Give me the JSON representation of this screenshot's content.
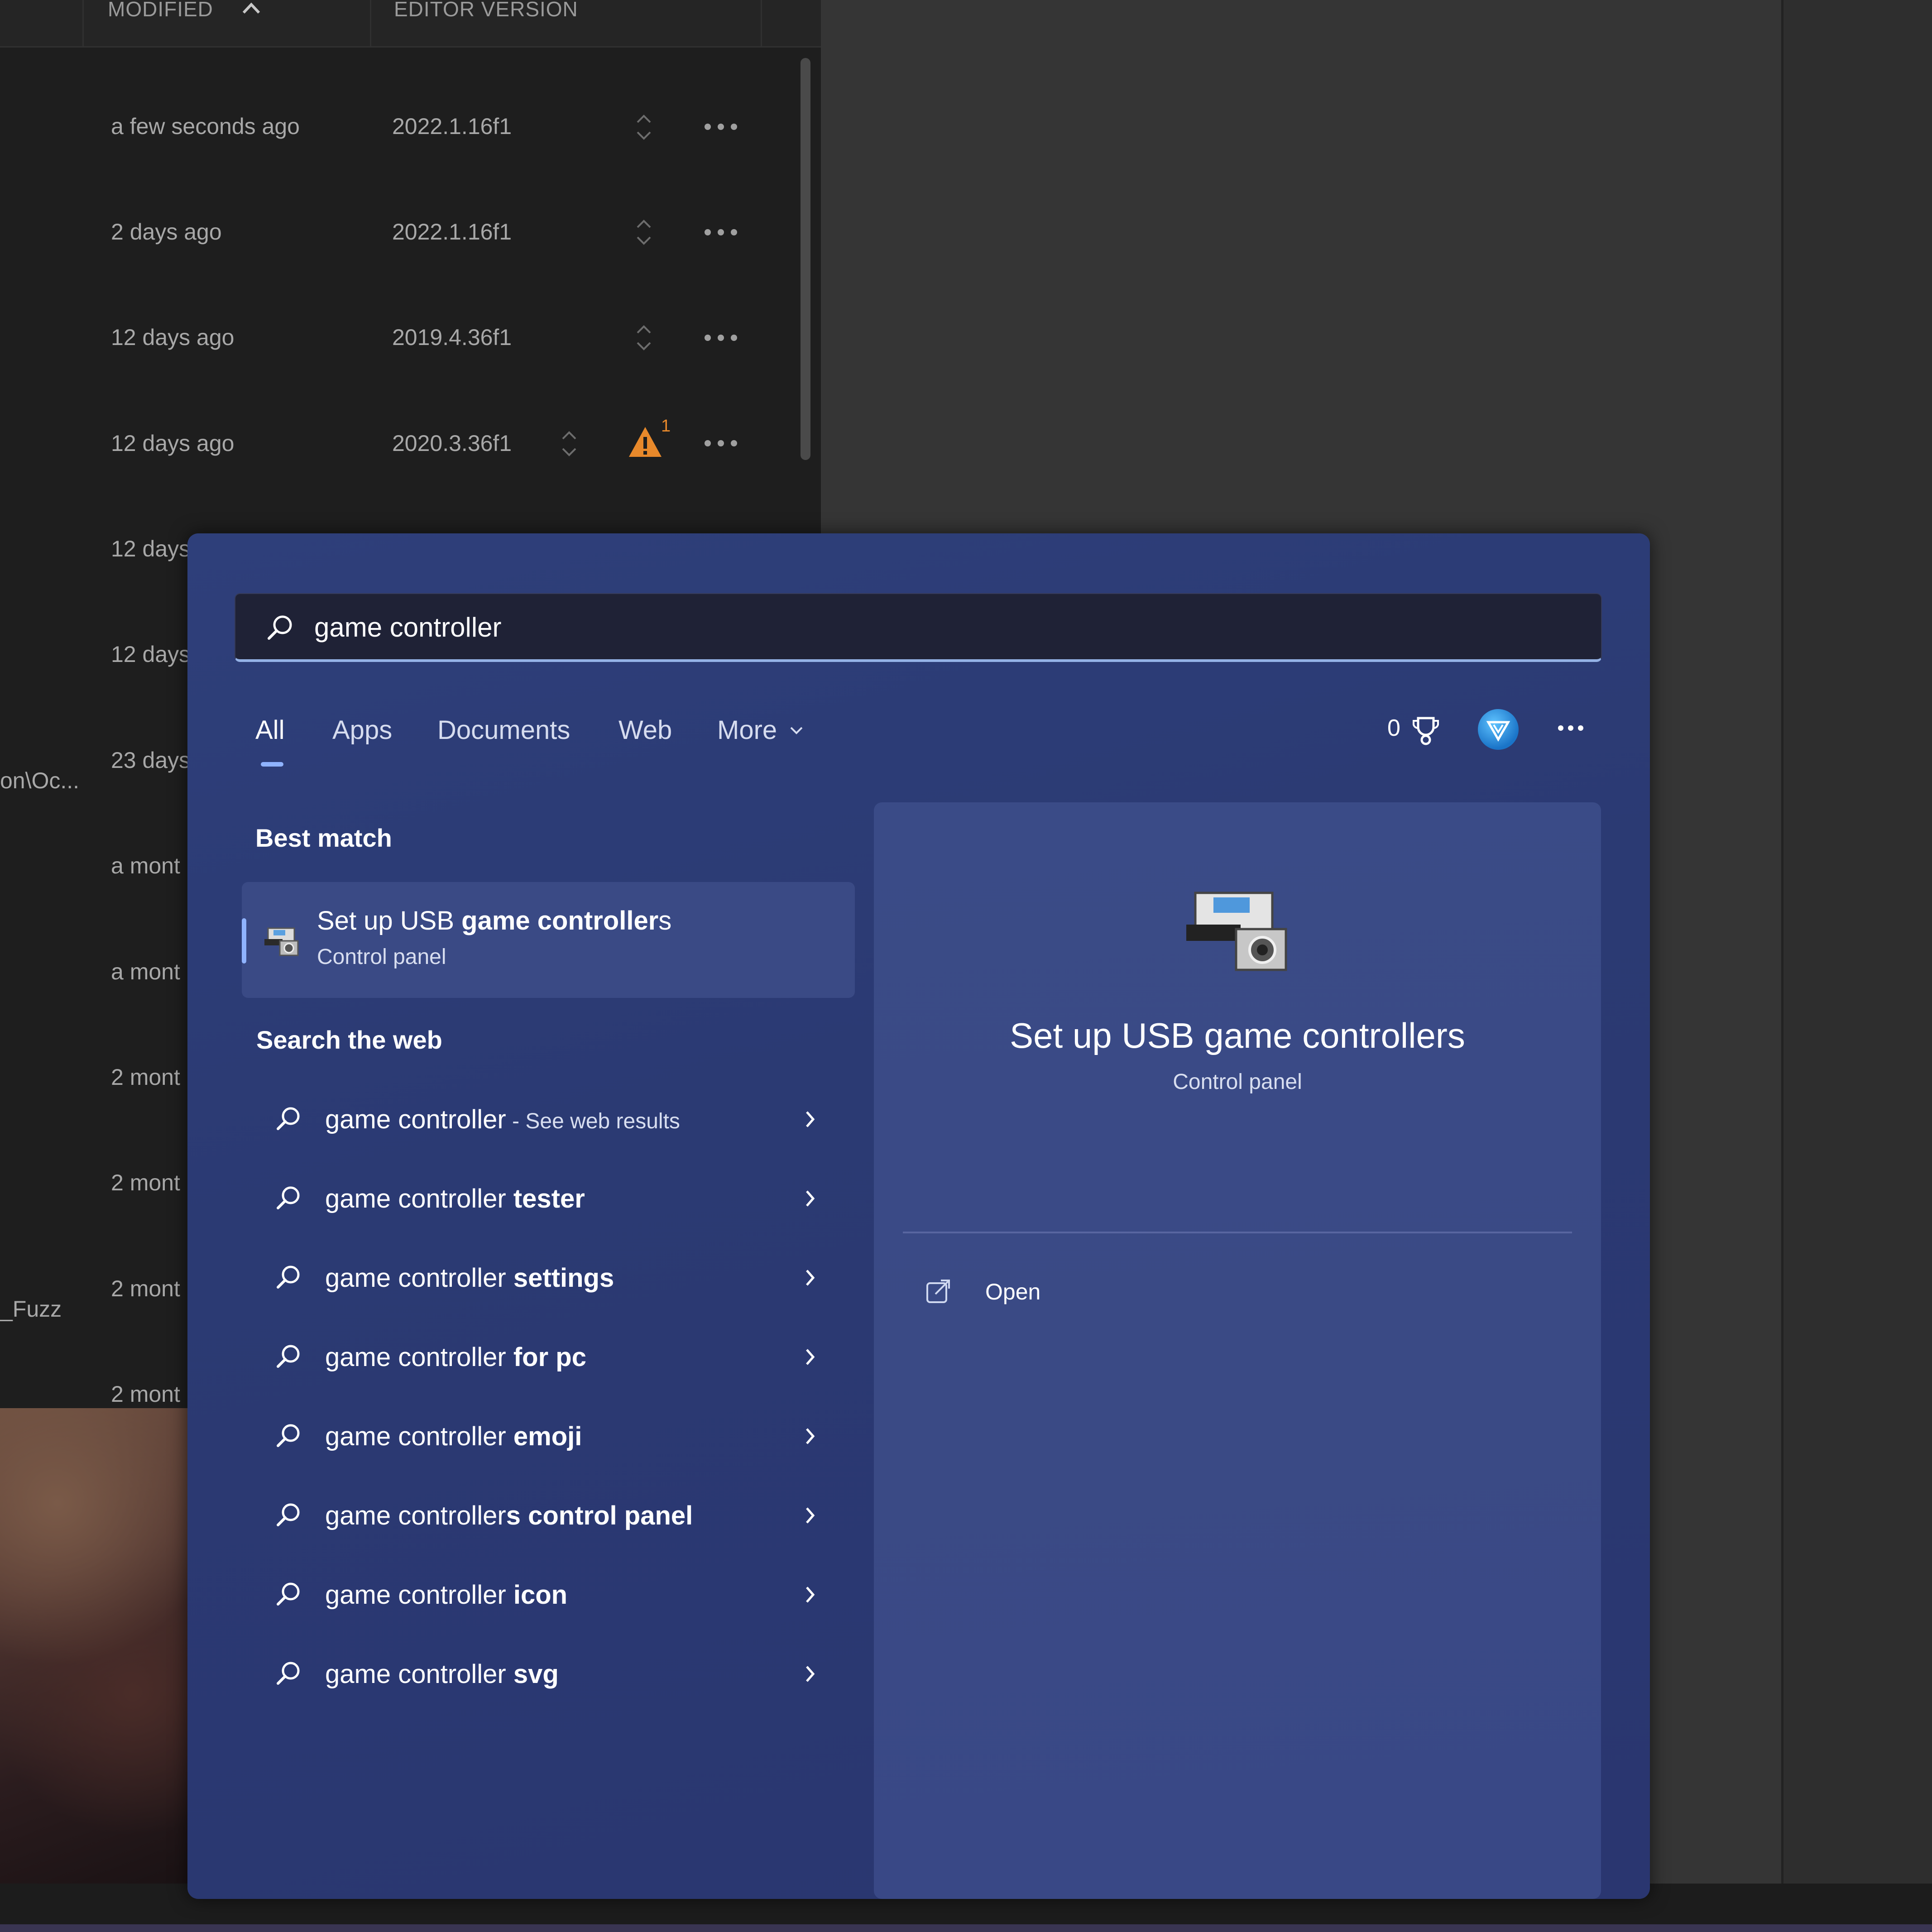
{
  "background_app": {
    "columns": {
      "modified": "MODIFIED",
      "editor_version": "EDITOR VERSION"
    },
    "rows": [
      {
        "modified": "a few seconds ago",
        "version": "2022.1.16f1"
      },
      {
        "modified": "2 days ago",
        "version": "2022.1.16f1"
      },
      {
        "modified": "12 days ago",
        "version": "2019.4.36f1"
      },
      {
        "modified": "12 days ago",
        "version": "2020.3.36f1",
        "warning_count": "1"
      },
      {
        "modified": "12 days"
      },
      {
        "modified": "12 days"
      },
      {
        "modified": "23 days",
        "path": "on\\Oc..."
      },
      {
        "modified": "a mont"
      },
      {
        "modified": "a mont"
      },
      {
        "modified": "2 mont"
      },
      {
        "modified": "2 mont"
      },
      {
        "modified": "2 mont",
        "path": "_Fuzz"
      },
      {
        "modified": "2 mont"
      }
    ],
    "colors": {
      "panel_bg": "#1e1e1e",
      "warning": "#e8892b"
    }
  },
  "search": {
    "query": "game controller",
    "tabs": [
      "All",
      "Apps",
      "Documents",
      "Web",
      "More"
    ],
    "active_tab": "All",
    "points": "0",
    "icons": {
      "search": "search-icon",
      "trophy": "trophy-icon",
      "more": "ellipsis-icon"
    }
  },
  "best_match": {
    "heading": "Best match",
    "title_prefix": "Set up USB ",
    "title_bold": "game controller",
    "title_suffix": "s",
    "subtitle": "Control panel"
  },
  "web": {
    "heading": "Search the web",
    "items": [
      {
        "prefix": "game controller",
        "bold": "",
        "suffix": " - See web results"
      },
      {
        "prefix": "game controller ",
        "bold": "tester",
        "suffix": ""
      },
      {
        "prefix": "game controller ",
        "bold": "settings",
        "suffix": ""
      },
      {
        "prefix": "game controller ",
        "bold": "for pc",
        "suffix": ""
      },
      {
        "prefix": "game controller ",
        "bold": "emoji",
        "suffix": ""
      },
      {
        "prefix": "game controller",
        "bold": "s control panel",
        "suffix": ""
      },
      {
        "prefix": "game controller ",
        "bold": "icon",
        "suffix": ""
      },
      {
        "prefix": "game controller ",
        "bold": "svg",
        "suffix": ""
      }
    ]
  },
  "preview": {
    "title": "Set up USB game controllers",
    "subtitle": "Control panel",
    "actions": [
      {
        "label": "Open",
        "icon": "open-external-icon"
      }
    ]
  },
  "colors": {
    "flyout_bg": "#2e3f7a",
    "accent": "#8fb3ff",
    "text": "#ffffff"
  }
}
